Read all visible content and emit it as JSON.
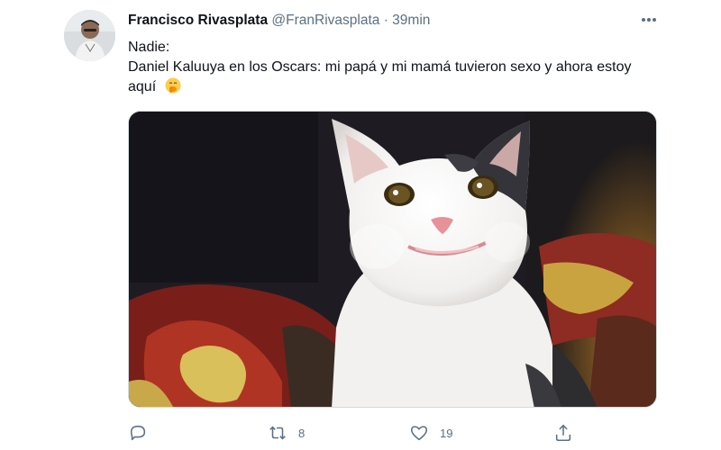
{
  "tweet": {
    "author_name": "Francisco Rivasplata",
    "handle": "@FranRivasplata",
    "separator": "·",
    "time": "39min",
    "text_line1": "Nadie:",
    "text_line2": "Daniel Kaluuya en los Oscars: mi papá y mi mamá tuvieron sexo y ahora estoy aquí",
    "emoji": "shushing-face-emoji",
    "media_description_icon": "cat-photo",
    "actions": {
      "reply_count": "",
      "retweet_count": "8",
      "like_count": "19",
      "share_count": ""
    }
  },
  "colors": {
    "text": "#0f1419",
    "secondary": "#5b7083",
    "border": "#cfd9de"
  },
  "icons": {
    "more": "more-horizontal-icon",
    "reply": "reply-icon",
    "retweet": "retweet-icon",
    "like": "heart-icon",
    "share": "share-icon"
  }
}
